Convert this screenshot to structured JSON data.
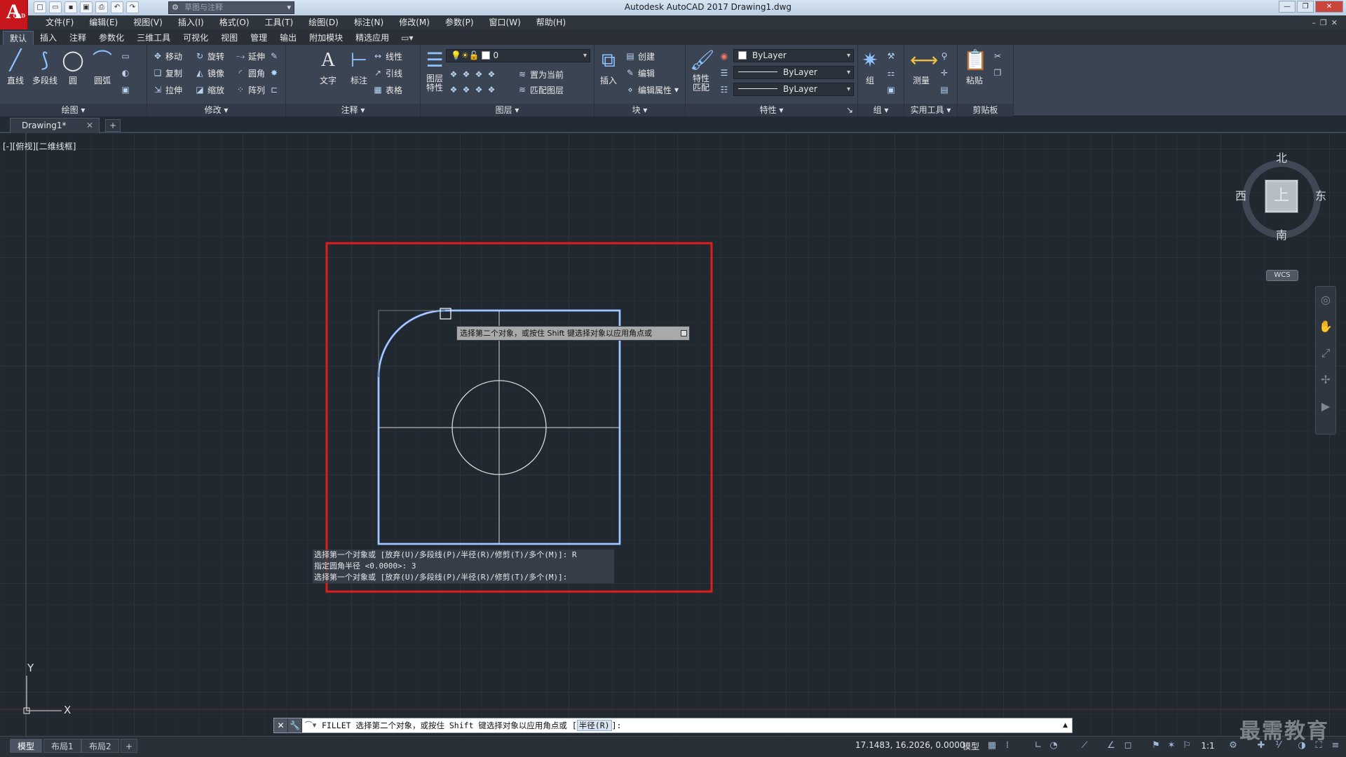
{
  "app": {
    "logo": "A",
    "logo_sub": "CAD",
    "title": "Autodesk AutoCAD 2017    Drawing1.dwg",
    "workspace": "草图与注释"
  },
  "menu": [
    "文件(F)",
    "编辑(E)",
    "视图(V)",
    "插入(I)",
    "格式(O)",
    "工具(T)",
    "绘图(D)",
    "标注(N)",
    "修改(M)",
    "参数(P)",
    "窗口(W)",
    "帮助(H)"
  ],
  "tabs": [
    "默认",
    "插入",
    "注释",
    "参数化",
    "三维工具",
    "可视化",
    "视图",
    "管理",
    "输出",
    "附加模块",
    "精选应用"
  ],
  "ribbon": {
    "draw": {
      "title": "绘图",
      "line": "直线",
      "polyline": "多段线",
      "circle": "圆",
      "arc": "圆弧"
    },
    "modify": {
      "title": "修改",
      "move": "移动",
      "rotate": "旋转",
      "extend": "延伸",
      "copy": "复制",
      "mirror": "镜像",
      "fillet": "圆角",
      "stretch": "拉伸",
      "scale": "缩放",
      "array": "阵列"
    },
    "annotation": {
      "title": "注释",
      "text": "文字",
      "dimension": "标注",
      "linear": "线性",
      "leader": "引线",
      "table": "表格"
    },
    "layers": {
      "title": "图层",
      "props": "图层",
      "props2": "特性",
      "current_layer": "0",
      "set_current": "置为当前",
      "match": "匹配图层"
    },
    "block": {
      "title": "块",
      "insert": "插入",
      "create": "创建",
      "edit": "编辑",
      "edit_attr": "编辑属性"
    },
    "properties": {
      "title": "特性",
      "match": "特性",
      "match2": "匹配",
      "color": "ByLayer",
      "linetype": "ByLayer",
      "lineweight": "ByLayer"
    },
    "groups": {
      "title": "组",
      "group": "组"
    },
    "utilities": {
      "title": "实用工具",
      "measure": "测量"
    },
    "clipboard": {
      "title": "剪贴板",
      "paste": "粘贴"
    }
  },
  "document": {
    "tab": "Drawing1*"
  },
  "viewport": {
    "label": "[-][俯视][二维线框]"
  },
  "viewcube": {
    "north": "北",
    "south": "南",
    "east": "东",
    "west": "西",
    "face": "上",
    "wcs": "WCS"
  },
  "tooltip": "选择第二个对象，或按住 Shift 键选择对象以应用角点或",
  "ucs": {
    "x": "X",
    "y": "Y"
  },
  "command_history": [
    "选择第一个对象或 [放弃(U)/多段线(P)/半径(R)/修剪(T)/多个(M)]: R",
    "指定圆角半径 <0.0000>: 3",
    "选择第一个对象或 [放弃(U)/多段线(P)/半径(R)/修剪(T)/多个(M)]:"
  ],
  "command_line": {
    "prefix": "FILLET 选择第二个对象，或按住 Shift 键选择对象以应用角点或 [",
    "option": "半径(R)",
    "suffix": "]:"
  },
  "layouts": [
    "模型",
    "布局1",
    "布局2"
  ],
  "status": {
    "coords": "17.1483, 16.2026, 0.0000",
    "model": "模型",
    "scale": "1:1"
  },
  "watermark": "最需教育",
  "colors": {
    "selection": "#6e9ff0",
    "highlight": "#e01c1c",
    "geometry": "#e0e0e0"
  }
}
